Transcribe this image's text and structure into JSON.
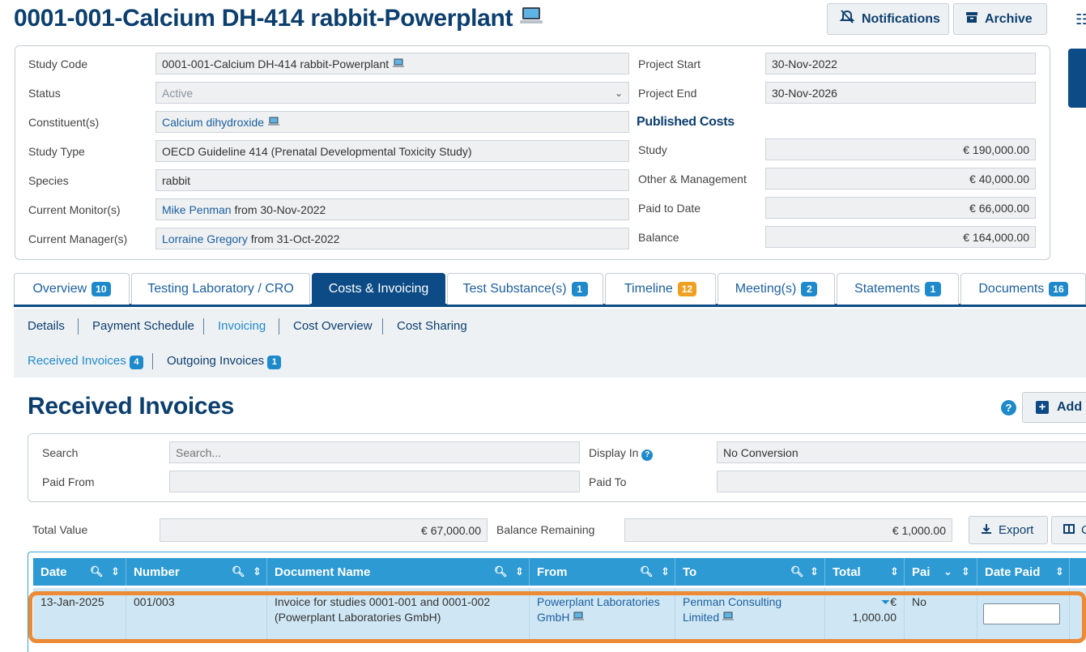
{
  "header": {
    "title": "0001-001-Calcium DH-414 rabbit-Powerplant",
    "notifications_label": "Notifications",
    "archive_label": "Archive"
  },
  "details": {
    "left": [
      {
        "label": "Study Code",
        "value": "0001-001-Calcium DH-414 rabbit-Powerplant"
      },
      {
        "label": "Status",
        "value": "Active"
      },
      {
        "label": "Constituent(s)",
        "value": "Calcium dihydroxide"
      },
      {
        "label": "Study Type",
        "value": "OECD Guideline 414 (Prenatal Developmental Toxicity Study)"
      },
      {
        "label": "Species",
        "value": "rabbit"
      },
      {
        "label": "Current Monitor(s)",
        "link": "Mike Penman",
        "suffix": " from 30-Nov-2022"
      },
      {
        "label": "Current Manager(s)",
        "link": "Lorraine Gregory",
        "suffix": " from 31-Oct-2022"
      }
    ],
    "right": [
      {
        "label": "Project Start",
        "value": "30-Nov-2022"
      },
      {
        "label": "Project End",
        "value": "30-Nov-2026"
      }
    ],
    "published_costs_heading": "Published Costs",
    "costs": [
      {
        "label": "Study",
        "value": "€ 190,000.00"
      },
      {
        "label": "Other & Management",
        "value": "€ 40,000.00"
      },
      {
        "label": "Paid to Date",
        "value": "€ 66,000.00"
      },
      {
        "label": "Balance",
        "value": "€ 164,000.00"
      }
    ]
  },
  "tabs": [
    {
      "label": "Overview",
      "badge": "10"
    },
    {
      "label": "Testing Laboratory / CRO",
      "badge": ""
    },
    {
      "label": "Costs & Invoicing",
      "badge": ""
    },
    {
      "label": "Test Substance(s)",
      "badge": "1"
    },
    {
      "label": "Timeline",
      "badge": "12"
    },
    {
      "label": "Meeting(s)",
      "badge": "2"
    },
    {
      "label": "Statements",
      "badge": "1"
    },
    {
      "label": "Documents",
      "badge": "16"
    }
  ],
  "subnav": {
    "row1": [
      "Details",
      "Payment Schedule",
      "Invoicing",
      "Cost Overview",
      "Cost Sharing"
    ],
    "row2": [
      {
        "label": "Received Invoices",
        "badge": "4"
      },
      {
        "label": "Outgoing Invoices",
        "badge": "1"
      }
    ]
  },
  "section": {
    "title": "Received Invoices",
    "add_label": "Add I"
  },
  "filters": {
    "search_label": "Search",
    "search_placeholder": "Search...",
    "display_in_label": "Display In",
    "display_in_value": "No Conversion",
    "paid_from_label": "Paid From",
    "paid_to_label": "Paid To"
  },
  "totals": {
    "total_value_label": "Total Value",
    "total_value": "€ 67,000.00",
    "balance_label": "Balance Remaining",
    "balance_value": "€ 1,000.00",
    "export_label": "Export",
    "columns_label": "C"
  },
  "table": {
    "columns": [
      "Date",
      "Number",
      "Document Name",
      "From",
      "To",
      "Total",
      "Pai",
      "Date Paid"
    ],
    "rows": [
      {
        "date": "13-Jan-2025",
        "number": "001/003",
        "document": "Invoice for studies 0001-001 and 0001-002 (Powerplant Laboratories GmbH)",
        "from": "Powerplant Laboratories GmbH",
        "to": "Penman Consulting Limited",
        "total_currency": "€",
        "total_amount": "1,000.00",
        "paid": "No"
      }
    ]
  },
  "colors": {
    "primary": "#0c4b85",
    "header_blue": "#2e9ad3",
    "row_highlight": "#cfe7f5",
    "highlight_border": "#ec8a35",
    "badge_blue": "#1f8acb",
    "badge_orange": "#f0a020"
  }
}
